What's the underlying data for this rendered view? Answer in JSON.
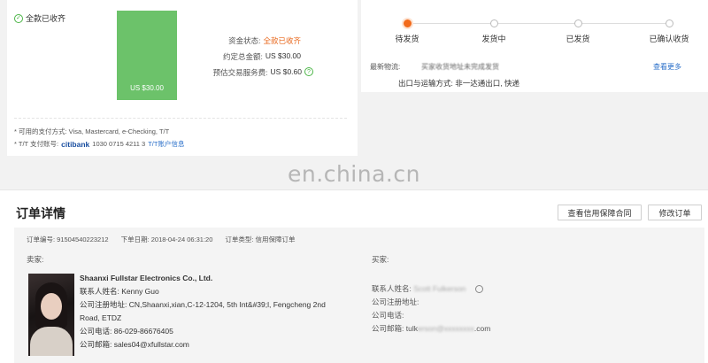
{
  "payment": {
    "paid_tag": "全款已收齐",
    "bar_amount": "US $30.00",
    "fund_status_label": "资金状态:",
    "fund_status_value": "全款已收齐",
    "total_label": "约定总金额:",
    "total_value": "US $30.00",
    "fee_label": "预估交易服务费:",
    "fee_value": "US $0.60",
    "methods": "* 可用的支付方式: Visa, Mastercard, e-Checking, T/T",
    "tt_label": "* T/T 支付账号:",
    "bank_logo": "citibank",
    "tt_account": "1030 0715 4211 3",
    "tt_link": "T/T账户信息",
    "colors": {
      "accent": "#e8661a",
      "bar": "#6cc26a"
    }
  },
  "tracking": {
    "steps": [
      {
        "label": "待发货",
        "active": true
      },
      {
        "label": "发货中",
        "active": false
      },
      {
        "label": "已发货",
        "active": false
      },
      {
        "label": "已确认收货",
        "active": false
      }
    ],
    "logistics_label": "最新物流:",
    "logistics_text": "买家收货地址未完成发货",
    "view_more": "查看更多",
    "ship_method_label": "出口与运输方式:",
    "ship_method_value": "非一达通出口, 快递"
  },
  "watermark": "en.china.cn",
  "order_detail": {
    "title": "订单详情",
    "btn_contract": "查看信用保障合同",
    "btn_modify": "修改订单",
    "order_no": "订单编号: 91504540223212",
    "order_date": "下单日期: 2018-04-24 06:31:20",
    "order_type": "订单类型: 信用保障订单",
    "seller": {
      "label": "卖家:",
      "company": "Shaanxi Fullstar Electronics Co., Ltd.",
      "contact": "联系人姓名:  Kenny Guo",
      "address": "公司注册地址: CN,Shaanxi,xian,C-12-1204, 5th Int&#39;l, Fengcheng 2nd Road, ETDZ",
      "phone": "公司电话:  86-029-86676405",
      "email": "公司邮箱:  sales04@xfullstar.com"
    },
    "buyer": {
      "label": "买家:",
      "contact_label": "联系人姓名:",
      "contact_value": "Scott Fulkerson",
      "address_label": "公司注册地址:",
      "phone_label": "公司电话:",
      "email_label": "公司邮箱:",
      "email_prefix": "tulk",
      "email_hidden": "erson@xxxxxxxx",
      "email_suffix": ".com"
    }
  }
}
